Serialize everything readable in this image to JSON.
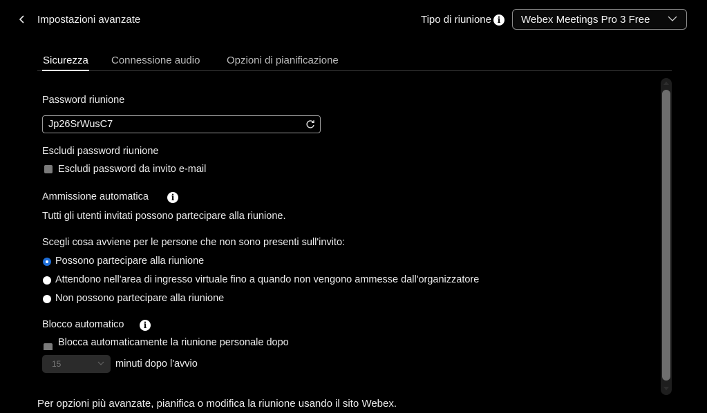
{
  "header": {
    "back_icon": "chevron-left-icon",
    "title": "Impostazioni avanzate",
    "meeting_type_label": "Tipo di riunione",
    "meeting_type_value": "Webex Meetings Pro 3 Free"
  },
  "tabs": [
    {
      "label": "Sicurezza",
      "active": true
    },
    {
      "label": "Connessione audio",
      "active": false
    },
    {
      "label": "Opzioni di pianificazione",
      "active": false
    }
  ],
  "security": {
    "password_label": "Password riunione",
    "password_value": "Jp26SrWusC7",
    "exclude_heading": "Escludi password riunione",
    "exclude_checkbox_label": "Escludi password da invito e-mail",
    "exclude_checked": false,
    "auto_admit_heading": "Ammissione automatica",
    "auto_admit_text": "Tutti gli utenti invitati possono partecipare alla riunione.",
    "uninvited_question": "Scegli cosa avviene per le persone che non sono presenti sull'invito:",
    "uninvited_options": [
      {
        "label": "Possono partecipare alla riunione",
        "selected": true
      },
      {
        "label": "Attendono nell'area di ingresso virtuale fino a quando non vengono ammesse dall'organizzatore",
        "selected": false
      },
      {
        "label": "Non possono partecipare alla riunione",
        "selected": false
      }
    ],
    "auto_lock_heading": "Blocco automatico",
    "auto_lock_checkbox_label": "Blocca automaticamente la riunione personale dopo",
    "auto_lock_checked": false,
    "auto_lock_minutes": "15",
    "auto_lock_suffix": "minuti dopo l'avvio"
  },
  "footer_text": "Per opzioni più avanzate, pianifica o modifica la riunione usando il sito Webex.",
  "colors": {
    "background": "#000000",
    "accent_radio": "#1f6fd9",
    "text": "#f2f2f2"
  }
}
